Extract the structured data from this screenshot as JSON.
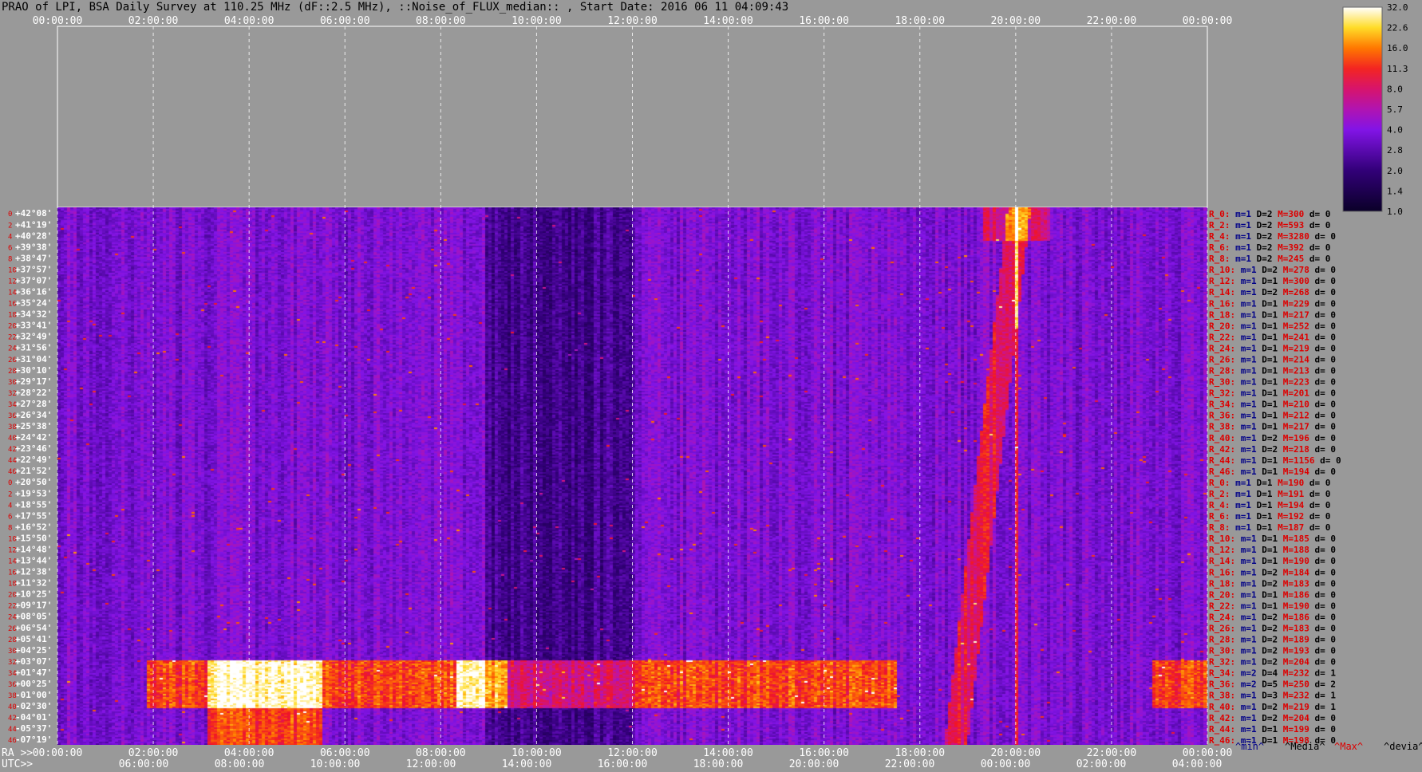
{
  "title": "PRAO of LPI, BSA Daily Survey at 110.25 MHz (dF::2.5 MHz), ::Noise_of_FLUX_median:: , Start Date: 2016 06 11 04:09:43",
  "chart_data": {
    "type": "heatmap",
    "utc_top_ticks": [
      "00:00:00",
      "02:00:00",
      "04:00:00",
      "06:00:00",
      "08:00:00",
      "10:00:00",
      "12:00:00",
      "14:00:00",
      "16:00:00",
      "18:00:00",
      "20:00:00",
      "22:00:00",
      "00:00:00"
    ],
    "ra_axis_label": "RA >>",
    "ra_ticks": [
      "00:00:00",
      "02:00:00",
      "04:00:00",
      "06:00:00",
      "08:00:00",
      "10:00:00",
      "12:00:00",
      "14:00:00",
      "16:00:00",
      "18:00:00",
      "20:00:00",
      "22:00:00",
      "00:00:00"
    ],
    "utc_axis_label": "UTC>>",
    "utc_bottom_ticks": [
      "06:00:00",
      "08:00:00",
      "10:00:00",
      "12:00:00",
      "14:00:00",
      "16:00:00",
      "18:00:00",
      "20:00:00",
      "22:00:00",
      "00:00:00",
      "02:00:00",
      "04:00:00"
    ],
    "declinations": [
      "+42°08'",
      "+41°19'",
      "+40°28'",
      "+39°38'",
      "+38°47'",
      "+37°57'",
      "+37°07'",
      "+36°16'",
      "+35°24'",
      "+34°32'",
      "+33°41'",
      "+32°49'",
      "+31°56'",
      "+31°04'",
      "+30°10'",
      "+29°17'",
      "+28°22'",
      "+27°28'",
      "+26°34'",
      "+25°38'",
      "+24°42'",
      "+23°46'",
      "+22°49'",
      "+21°52'",
      "+20°50'",
      "+19°53'",
      "+18°55'",
      "+17°55'",
      "+16°52'",
      "+15°50'",
      "+14°48'",
      "+13°44'",
      "+12°38'",
      "+11°32'",
      "+10°25'",
      "+09°17'",
      "+08°05'",
      "+06°54'",
      "+05°41'",
      "+04°25'",
      "+03°07'",
      "+01°47'",
      "+00°25'",
      "-01°00'",
      "-02°30'",
      "-04°01'",
      "-05°37'",
      "-07°19'"
    ],
    "rows_left_index": [
      "0",
      "2",
      "4",
      "6",
      "8",
      "10",
      "12",
      "14",
      "16",
      "18",
      "20",
      "22",
      "24",
      "26",
      "28",
      "30",
      "32",
      "34",
      "36",
      "38",
      "40",
      "42",
      "44",
      "46",
      "0",
      "2",
      "4",
      "6",
      "8",
      "10",
      "12",
      "14",
      "16",
      "18",
      "20",
      "22",
      "24",
      "26",
      "28",
      "30",
      "32",
      "34",
      "36",
      "38",
      "40",
      "42",
      "44",
      "46"
    ],
    "row_stats": [
      {
        "r": "R_0:",
        "m": "m=1",
        "D": "D=2",
        "M": "M=300",
        "d": "d= 0"
      },
      {
        "r": "R_2:",
        "m": "m=1",
        "D": "D=2",
        "M": "M=593",
        "d": "d= 0"
      },
      {
        "r": "R_4:",
        "m": "m=1",
        "D": "D=2",
        "M": "M=3280",
        "d": "d= 0"
      },
      {
        "r": "R_6:",
        "m": "m=1",
        "D": "D=2",
        "M": "M=392",
        "d": "d= 0"
      },
      {
        "r": "R_8:",
        "m": "m=1",
        "D": "D=2",
        "M": "M=245",
        "d": "d= 0"
      },
      {
        "r": "R_10:",
        "m": "m=1",
        "D": "D=2",
        "M": "M=278",
        "d": "d= 0"
      },
      {
        "r": "R_12:",
        "m": "m=1",
        "D": "D=1",
        "M": "M=300",
        "d": "d= 0"
      },
      {
        "r": "R_14:",
        "m": "m=1",
        "D": "D=2",
        "M": "M=268",
        "d": "d= 0"
      },
      {
        "r": "R_16:",
        "m": "m=1",
        "D": "D=1",
        "M": "M=229",
        "d": "d= 0"
      },
      {
        "r": "R_18:",
        "m": "m=1",
        "D": "D=1",
        "M": "M=217",
        "d": "d= 0"
      },
      {
        "r": "R_20:",
        "m": "m=1",
        "D": "D=1",
        "M": "M=252",
        "d": "d= 0"
      },
      {
        "r": "R_22:",
        "m": "m=1",
        "D": "D=1",
        "M": "M=241",
        "d": "d= 0"
      },
      {
        "r": "R_24:",
        "m": "m=1",
        "D": "D=1",
        "M": "M=219",
        "d": "d= 0"
      },
      {
        "r": "R_26:",
        "m": "m=1",
        "D": "D=1",
        "M": "M=214",
        "d": "d= 0"
      },
      {
        "r": "R_28:",
        "m": "m=1",
        "D": "D=1",
        "M": "M=213",
        "d": "d= 0"
      },
      {
        "r": "R_30:",
        "m": "m=1",
        "D": "D=1",
        "M": "M=223",
        "d": "d= 0"
      },
      {
        "r": "R_32:",
        "m": "m=1",
        "D": "D=1",
        "M": "M=201",
        "d": "d= 0"
      },
      {
        "r": "R_34:",
        "m": "m=1",
        "D": "D=1",
        "M": "M=210",
        "d": "d= 0"
      },
      {
        "r": "R_36:",
        "m": "m=1",
        "D": "D=1",
        "M": "M=212",
        "d": "d= 0"
      },
      {
        "r": "R_38:",
        "m": "m=1",
        "D": "D=1",
        "M": "M=217",
        "d": "d= 0"
      },
      {
        "r": "R_40:",
        "m": "m=1",
        "D": "D=2",
        "M": "M=196",
        "d": "d= 0"
      },
      {
        "r": "R_42:",
        "m": "m=1",
        "D": "D=2",
        "M": "M=218",
        "d": "d= 0"
      },
      {
        "r": "R_44:",
        "m": "m=1",
        "D": "D=1",
        "M": "M=1156",
        "d": "d= 0"
      },
      {
        "r": "R_46:",
        "m": "m=1",
        "D": "D=1",
        "M": "M=194",
        "d": "d= 0"
      },
      {
        "r": "R_0:",
        "m": "m=1",
        "D": "D=1",
        "M": "M=190",
        "d": "d= 0"
      },
      {
        "r": "R_2:",
        "m": "m=1",
        "D": "D=1",
        "M": "M=191",
        "d": "d= 0"
      },
      {
        "r": "R_4:",
        "m": "m=1",
        "D": "D=1",
        "M": "M=194",
        "d": "d= 0"
      },
      {
        "r": "R_6:",
        "m": "m=1",
        "D": "D=1",
        "M": "M=192",
        "d": "d= 0"
      },
      {
        "r": "R_8:",
        "m": "m=1",
        "D": "D=1",
        "M": "M=187",
        "d": "d= 0"
      },
      {
        "r": "R_10:",
        "m": "m=1",
        "D": "D=1",
        "M": "M=185",
        "d": "d= 0"
      },
      {
        "r": "R_12:",
        "m": "m=1",
        "D": "D=1",
        "M": "M=188",
        "d": "d= 0"
      },
      {
        "r": "R_14:",
        "m": "m=1",
        "D": "D=1",
        "M": "M=190",
        "d": "d= 0"
      },
      {
        "r": "R_16:",
        "m": "m=1",
        "D": "D=2",
        "M": "M=184",
        "d": "d= 0"
      },
      {
        "r": "R_18:",
        "m": "m=1",
        "D": "D=2",
        "M": "M=183",
        "d": "d= 0"
      },
      {
        "r": "R_20:",
        "m": "m=1",
        "D": "D=1",
        "M": "M=186",
        "d": "d= 0"
      },
      {
        "r": "R_22:",
        "m": "m=1",
        "D": "D=1",
        "M": "M=190",
        "d": "d= 0"
      },
      {
        "r": "R_24:",
        "m": "m=1",
        "D": "D=2",
        "M": "M=186",
        "d": "d= 0"
      },
      {
        "r": "R_26:",
        "m": "m=1",
        "D": "D=2",
        "M": "M=183",
        "d": "d= 0"
      },
      {
        "r": "R_28:",
        "m": "m=1",
        "D": "D=2",
        "M": "M=189",
        "d": "d= 0"
      },
      {
        "r": "R_30:",
        "m": "m=1",
        "D": "D=2",
        "M": "M=193",
        "d": "d= 0"
      },
      {
        "r": "R_32:",
        "m": "m=1",
        "D": "D=2",
        "M": "M=204",
        "d": "d= 0"
      },
      {
        "r": "R_34:",
        "m": "m=2",
        "D": "D=4",
        "M": "M=232",
        "d": "d= 1"
      },
      {
        "r": "R_36:",
        "m": "m=2",
        "D": "D=5",
        "M": "M=250",
        "d": "d= 2"
      },
      {
        "r": "R_38:",
        "m": "m=1",
        "D": "D=3",
        "M": "M=232",
        "d": "d= 1"
      },
      {
        "r": "R_40:",
        "m": "m=1",
        "D": "D=2",
        "M": "M=219",
        "d": "d= 1"
      },
      {
        "r": "R_42:",
        "m": "m=1",
        "D": "D=2",
        "M": "M=204",
        "d": "d= 0"
      },
      {
        "r": "R_44:",
        "m": "m=1",
        "D": "D=1",
        "M": "M=199",
        "d": "d= 0"
      },
      {
        "r": "R_46:",
        "m": "m=1",
        "D": "D=1",
        "M": "M=198",
        "d": "d= 0"
      }
    ],
    "stats_legend": [
      "^min^",
      "^Media^",
      "^Max^",
      "^devia^"
    ],
    "colorbar_ticks": [
      "32.0",
      "22.6",
      "16.0",
      "11.3",
      "8.0",
      "5.7",
      "4.0",
      "2.8",
      "2.0",
      "1.4",
      "1.0"
    ],
    "colors": {
      "background": "#999999",
      "text_red": "#dd0000",
      "text_blue": "#000088",
      "gridline": "#ffffff"
    }
  }
}
